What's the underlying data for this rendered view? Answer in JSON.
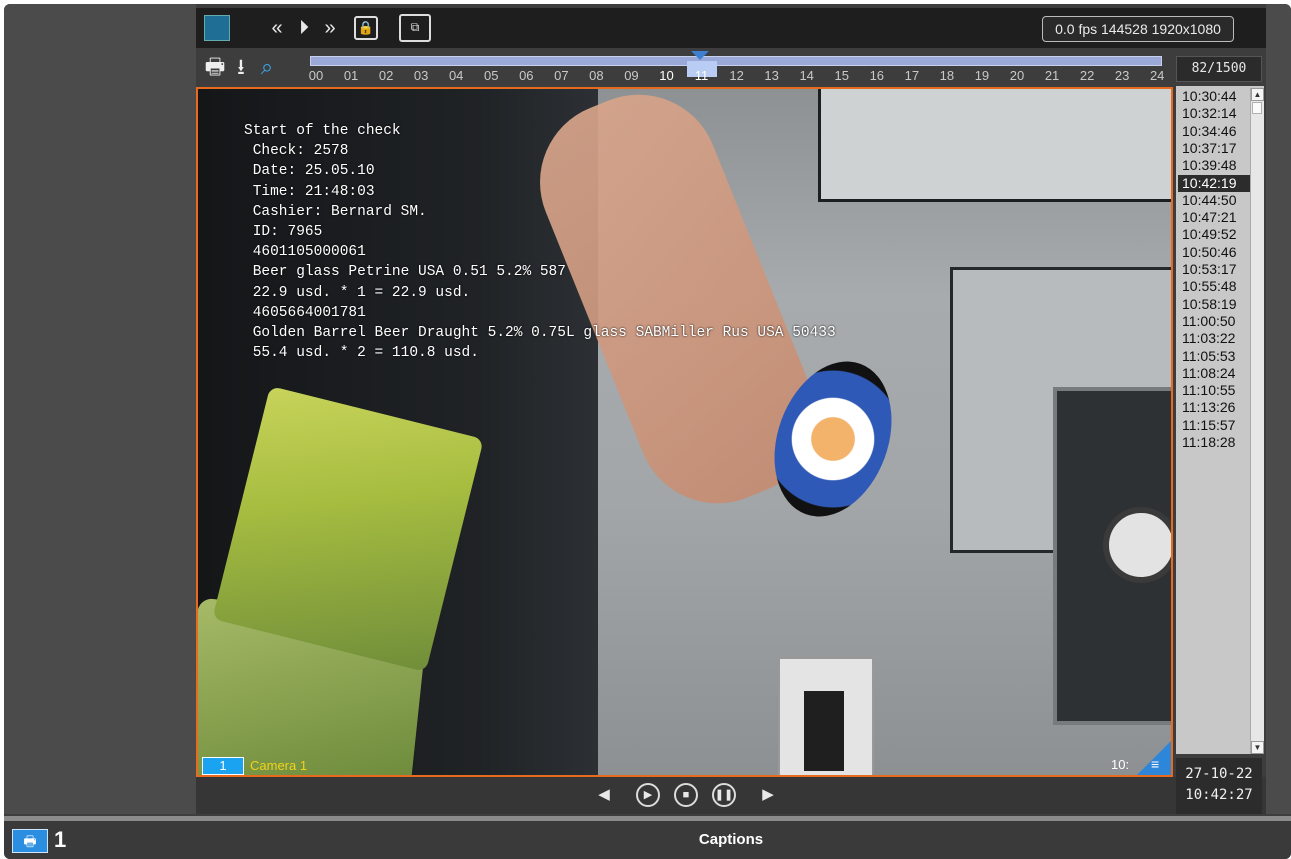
{
  "toolbar": {
    "icons": [
      "stop-icon",
      "rewind-icon",
      "play-icon",
      "fast-forward-icon",
      "lock-icon",
      "tape-export-icon"
    ],
    "status": "0.0 fps 144528 1920x1080"
  },
  "timeline": {
    "tools": [
      "print-icon",
      "download-icon",
      "search-icon"
    ],
    "ticks": [
      "00",
      "01",
      "02",
      "03",
      "04",
      "05",
      "06",
      "07",
      "08",
      "09",
      "10",
      "11",
      "12",
      "13",
      "14",
      "15",
      "16",
      "17",
      "18",
      "19",
      "20",
      "21",
      "22",
      "23",
      "24"
    ],
    "highlight": [
      "10",
      "11"
    ],
    "position_hour": 11
  },
  "frame_counter": "82/1500",
  "overlay_lines": [
    "Start of the check",
    " Check: 2578",
    " Date: 25.05.10",
    " Time: 21:48:03",
    " Cashier: Bernard SM.",
    " ID: 7965",
    " 4601105000061",
    " Beer glass Petrine USA 0.51 5.2% 587",
    " 22.9 usd. * 1 = 22.9 usd.",
    " 4605664001781",
    " Golden Barrel Beer Draught 5.2% 0.75L glass SABMiller Rus USA 50433",
    " 55.4 usd. * 2 = 110.8 usd."
  ],
  "camera": {
    "number": "1",
    "name": "Camera 1",
    "scale": "10:"
  },
  "playback": [
    "prev-icon",
    "play-icon",
    "stop-icon",
    "pause-icon",
    "next-icon"
  ],
  "times": [
    "10:30:44",
    "10:32:14",
    "10:34:46",
    "10:37:17",
    "10:39:48",
    "10:42:19",
    "10:44:50",
    "10:47:21",
    "10:49:52",
    "10:50:46",
    "10:53:17",
    "10:55:48",
    "10:58:19",
    "11:00:50",
    "11:03:22",
    "11:05:53",
    "11:08:24",
    "11:10:55",
    "11:13:26",
    "11:15:57",
    "11:18:28"
  ],
  "selected_time_index": 5,
  "datetime": {
    "date": "27-10-22",
    "time": "10:42:27"
  },
  "bottom": {
    "monitor_number": "1",
    "caption": "Captions"
  }
}
